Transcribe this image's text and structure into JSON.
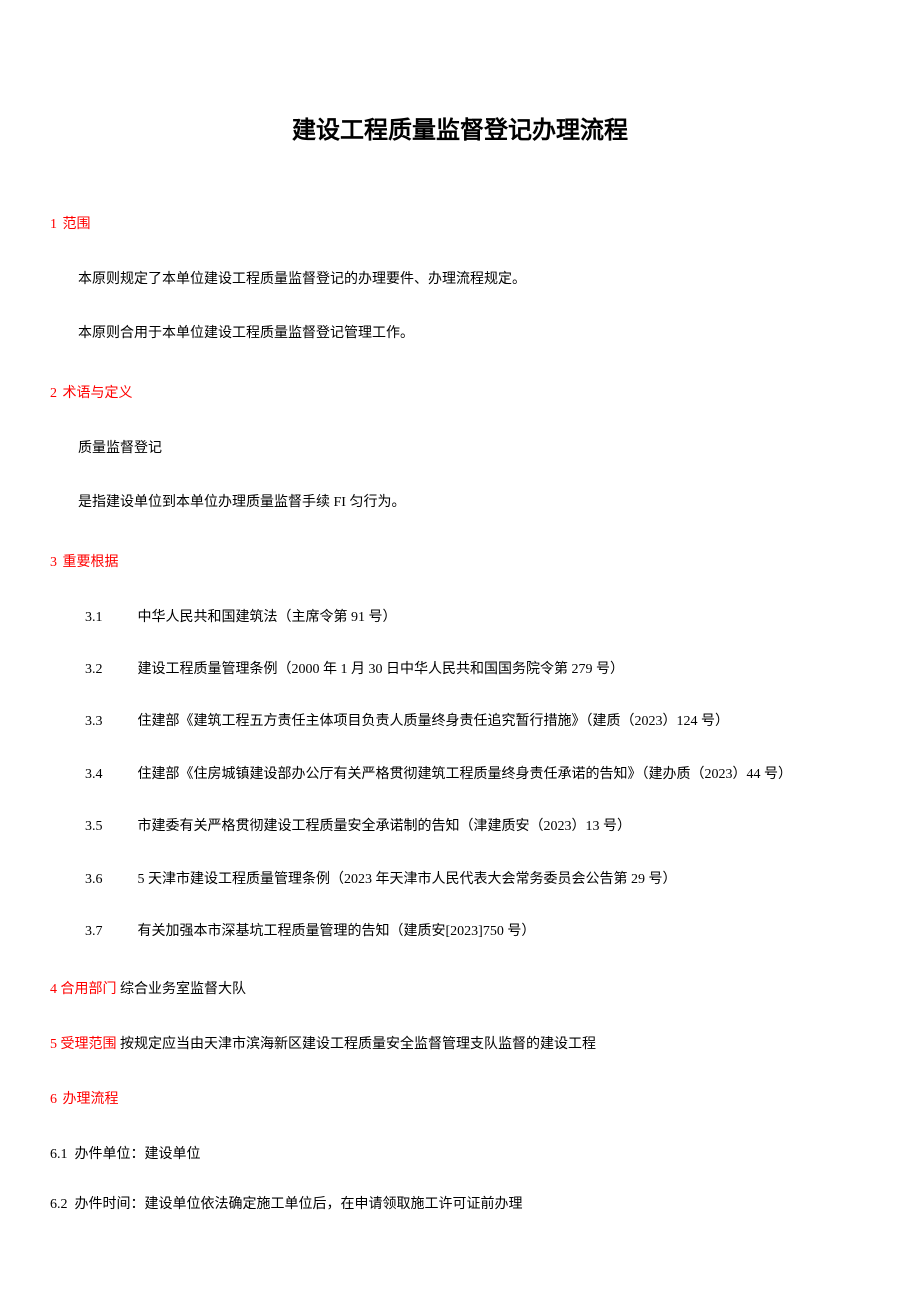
{
  "title": "建设工程质量监督登记办理流程",
  "sections": {
    "s1": {
      "num": "1",
      "heading": "范围",
      "p1": "本原则规定了本单位建设工程质量监督登记的办理要件、办理流程规定。",
      "p2": "本原则合用于本单位建设工程质量监督登记管理工作。"
    },
    "s2": {
      "num": "2",
      "heading": "术语与定义",
      "p1": "质量监督登记",
      "p2": "是指建设单位到本单位办理质量监督手续 FI 匀行为。"
    },
    "s3": {
      "num": "3",
      "heading": "重要根据",
      "items": [
        {
          "num": "3.1",
          "text": "中华人民共和国建筑法（主席令第 91 号）"
        },
        {
          "num": "3.2",
          "text": "建设工程质量管理条例（2000 年 1 月 30 日中华人民共和国国务院令第 279 号）"
        },
        {
          "num": "3.3",
          "text": "住建部《建筑工程五方责任主体项目负责人质量终身责任追究暂行措施》（建质（2023）124 号）"
        },
        {
          "num": "3.4",
          "text": "住建部《住房城镇建设部办公厅有关严格贯彻建筑工程质量终身责任承诺的告知》（建办质（2023）44 号）"
        },
        {
          "num": "3.5",
          "text": "市建委有关严格贯彻建设工程质量安全承诺制的告知（津建质安（2023）13 号）"
        },
        {
          "num": "3.6",
          "text": "5 天津市建设工程质量管理条例（2023 年天津市人民代表大会常务委员会公告第 29 号）"
        },
        {
          "num": "3.7",
          "text": "有关加强本市深基坑工程质量管理的告知（建质安[2023]750 号）"
        }
      ]
    },
    "s4": {
      "num": "4",
      "heading": "合用部门",
      "text": "综合业务室监督大队"
    },
    "s5": {
      "num": "5",
      "heading": "受理范围",
      "text": "按规定应当由天津市滨海新区建设工程质量安全监督管理支队监督的建设工程"
    },
    "s6": {
      "num": "6",
      "heading": "办理流程",
      "items": [
        {
          "num": "6.1",
          "text": "办件单位：建设单位"
        },
        {
          "num": "6.2",
          "text": "办件时间：建设单位依法确定施工单位后，在申请领取施工许可证前办理"
        }
      ]
    }
  }
}
